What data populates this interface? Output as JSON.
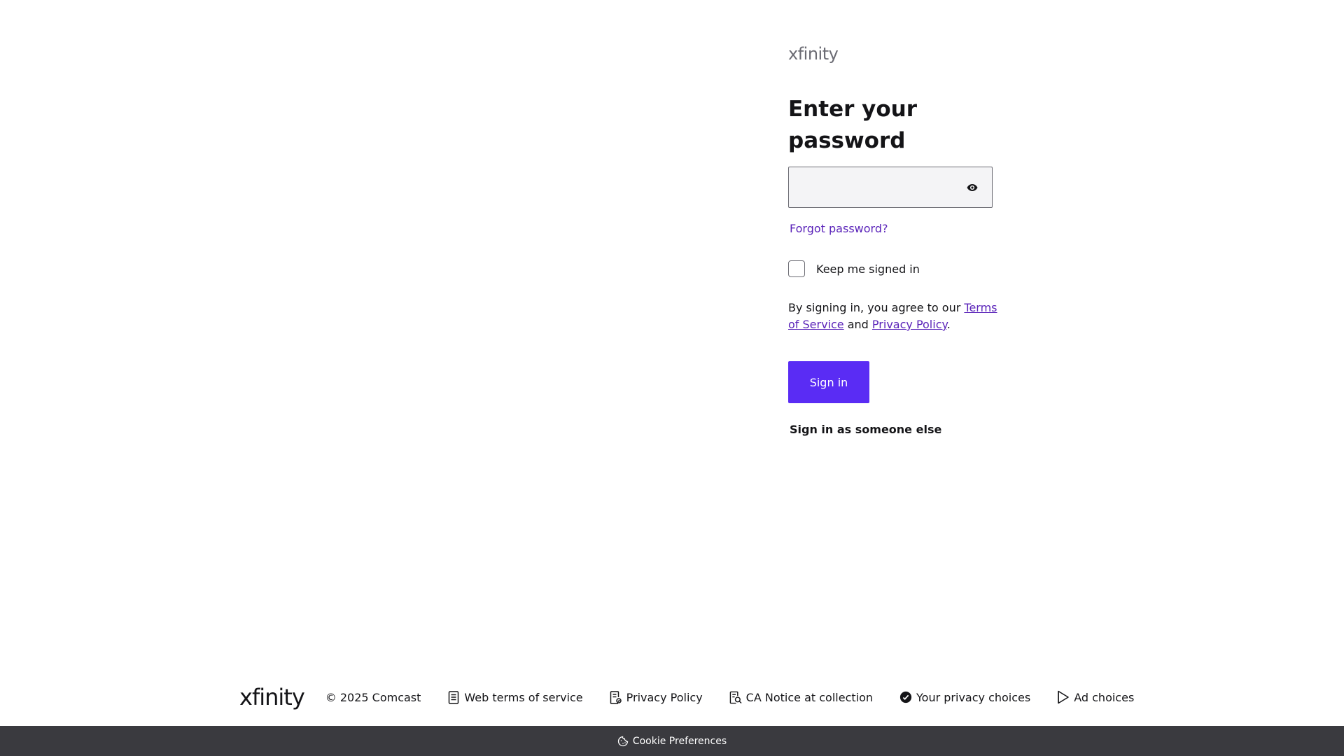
{
  "brand": {
    "logo_text": "xfinity"
  },
  "signin": {
    "heading": "Enter your password",
    "password_value": "",
    "show_password_icon": "eye-icon",
    "forgot_password": "Forgot password?",
    "keep_signed_in_label": "Keep me signed in",
    "keep_signed_in_checked": false,
    "legal_prefix": "By signing in, you agree to our ",
    "terms_link": "Terms of Service",
    "legal_and": " and ",
    "privacy_link": "Privacy Policy",
    "legal_suffix": ".",
    "signin_button": "Sign in",
    "someone_else": "Sign in as someone else"
  },
  "footer": {
    "logo_text": "xfinity",
    "copyright": "© 2025 Comcast",
    "links": [
      {
        "label": "Web terms of service",
        "icon": "document-icon"
      },
      {
        "label": "Privacy Policy",
        "icon": "policy-document-icon"
      },
      {
        "label": "CA Notice at collection",
        "icon": "document-search-icon"
      },
      {
        "label": "Your privacy choices",
        "icon": "privacy-toggle-icon"
      },
      {
        "label": "Ad choices",
        "icon": "ad-choices-icon"
      }
    ]
  },
  "cookie_bar": {
    "label": "Cookie Preferences",
    "icon": "cookie-icon"
  },
  "colors": {
    "accent": "#5a2cf4",
    "link": "#5a23b9",
    "text": "#141417",
    "cookie_bar_bg": "#3a3a3f",
    "field_bg": "#f4f4f6"
  }
}
